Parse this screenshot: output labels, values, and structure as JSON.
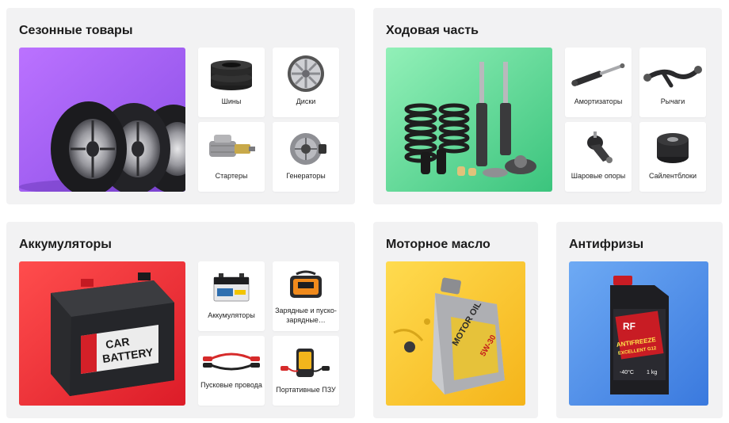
{
  "panels": {
    "seasonal": {
      "title": "Сезонные товары",
      "hero_colors": [
        "#b46dff",
        "#8f4fe8"
      ],
      "tiles": [
        {
          "label": "Шины",
          "icon": "tires-icon"
        },
        {
          "label": "Диски",
          "icon": "rim-icon"
        },
        {
          "label": "Стартеры",
          "icon": "starter-icon"
        },
        {
          "label": "Генераторы",
          "icon": "alternator-icon"
        }
      ]
    },
    "chassis": {
      "title": "Ходовая часть",
      "hero_colors": [
        "#8ff0b6",
        "#39c77c"
      ],
      "tiles": [
        {
          "label": "Амортизаторы",
          "icon": "shock-absorber-icon"
        },
        {
          "label": "Рычаги",
          "icon": "control-arm-icon"
        },
        {
          "label": "Шаровые опоры",
          "icon": "ball-joint-icon"
        },
        {
          "label": "Сайлентблоки",
          "icon": "silent-block-icon"
        }
      ]
    },
    "batteries": {
      "title": "Аккумуляторы",
      "hero_colors": [
        "#ff4a4a",
        "#e01e2a"
      ],
      "hero_text_1": "CAR",
      "hero_text_2": "BATTERY",
      "tiles": [
        {
          "label": "Аккумуляторы",
          "icon": "battery-icon"
        },
        {
          "label": "Зарядные и пуско-зарядные…",
          "icon": "charger-icon"
        },
        {
          "label": "Пусковые провода",
          "icon": "jumper-cables-icon"
        },
        {
          "label": "Портативные ПЗУ",
          "icon": "jump-starter-icon"
        }
      ]
    },
    "engine_oil": {
      "title": "Моторное масло",
      "hero_colors": [
        "#ffd84a",
        "#f6b81c"
      ],
      "hero_text_1": "MOTOR OIL",
      "hero_text_2": "5W-30"
    },
    "antifreeze": {
      "title": "Антифризы",
      "hero_colors": [
        "#6aaaf3",
        "#3d7fe0"
      ],
      "hero_text_1": "RF",
      "hero_text_2": "ANTIFREEZE",
      "hero_text_3": "EXCELLENT G12",
      "hero_text_4": "-40°C",
      "hero_text_5": "1 kg"
    }
  }
}
